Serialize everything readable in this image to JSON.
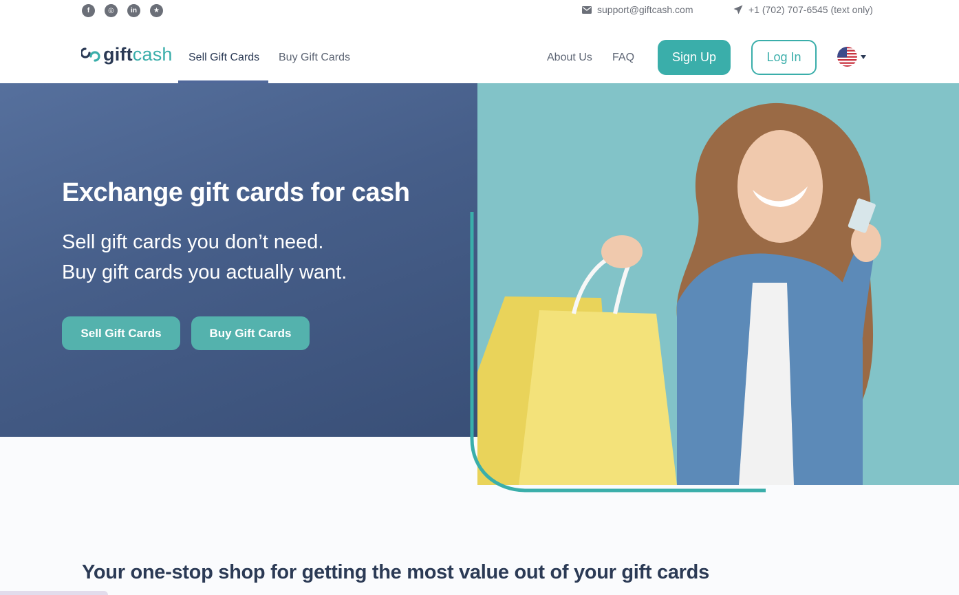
{
  "topbar": {
    "social": [
      {
        "icon": "facebook-icon",
        "glyph": "f"
      },
      {
        "icon": "instagram-icon",
        "glyph": "◎"
      },
      {
        "icon": "linkedin-icon",
        "glyph": "in"
      },
      {
        "icon": "star-icon",
        "glyph": "★"
      }
    ],
    "email": "support@giftcash.com",
    "phone": "+1 (702) 707-6545 (text only)"
  },
  "nav": {
    "logo_gift": "gift",
    "logo_cash": "cash",
    "links": {
      "sell": "Sell Gift Cards",
      "buy": "Buy Gift Cards",
      "about": "About Us",
      "faq": "FAQ"
    },
    "signup": "Sign Up",
    "login": "Log In",
    "language_icon": "us-flag-icon"
  },
  "hero": {
    "title": "Exchange gift cards for cash",
    "subtitle_line1": "Sell gift cards you don’t need.",
    "subtitle_line2": "Buy gift cards you actually want.",
    "sell_button": "Sell Gift Cards",
    "buy_button": "Buy Gift Cards"
  },
  "section": {
    "title": "Your one-stop shop for getting the most value out of your gift cards"
  },
  "colors": {
    "accent": "#3aaeaa",
    "navy": "#2b3a55",
    "hero_panel": "#4a628e"
  }
}
